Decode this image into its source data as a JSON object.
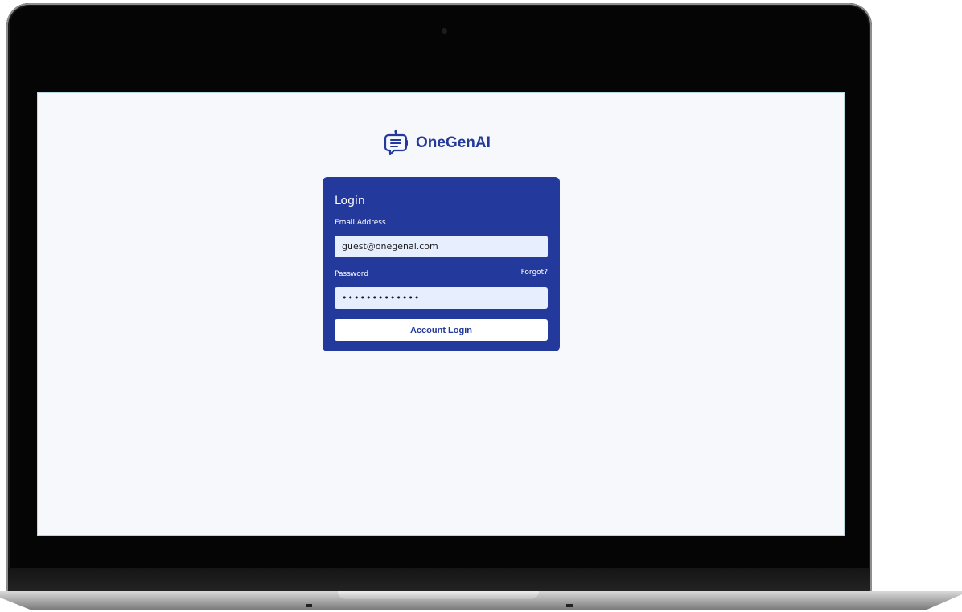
{
  "brand": {
    "name": "OneGenAI",
    "icon": "chatbot-icon",
    "color": "#233a9a"
  },
  "login": {
    "title": "Login",
    "email_label": "Email Address",
    "email_value": "guest@onegenai.com",
    "password_label": "Password",
    "forgot_label": "Forgot?",
    "password_value": "•••••••••••••",
    "button_label": "Account Login",
    "card_color": "#23399b"
  }
}
